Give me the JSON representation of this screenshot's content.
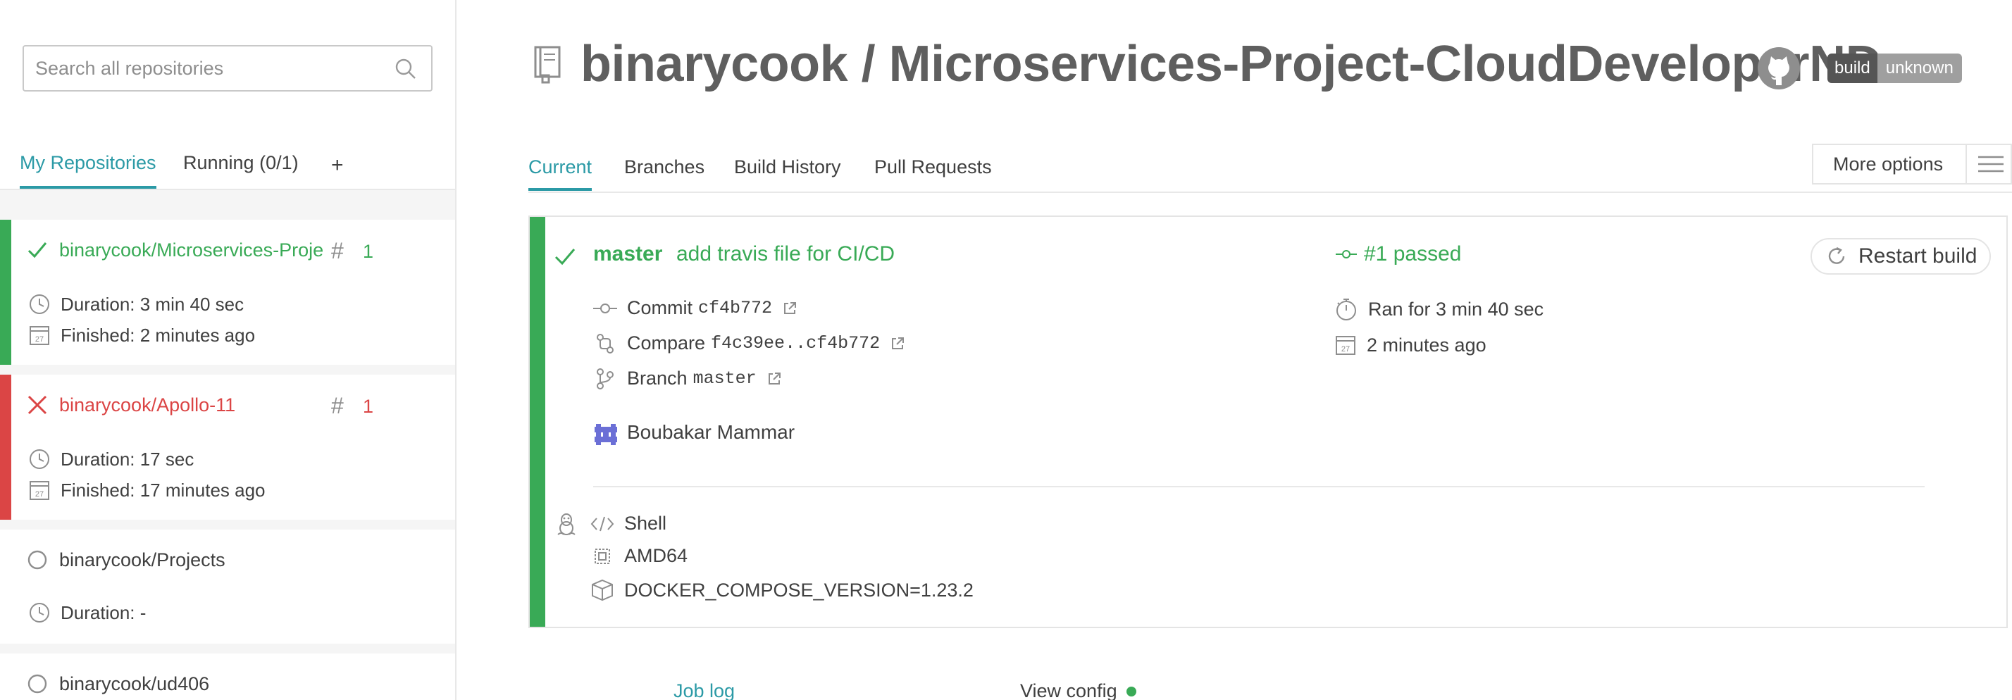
{
  "sidebar": {
    "search_placeholder": "Search all repositories",
    "tabs": [
      {
        "label": "My Repositories",
        "active": true
      },
      {
        "label": "Running (0/1)",
        "active": false
      },
      {
        "label": "+",
        "active": false
      }
    ],
    "repos": [
      {
        "name": "binarycook/Microservices-Project-CloudDeveloperND",
        "status": "passed",
        "hash": "#",
        "number": "1",
        "duration": "Duration: 3 min 40 sec",
        "finished": "Finished: 2 minutes ago",
        "color": "#39aa56"
      },
      {
        "name": "binarycook/Apollo-11",
        "status": "failed",
        "hash": "#",
        "number": "1",
        "duration": "Duration: 17 sec",
        "finished": "Finished: 17 minutes ago",
        "color": "#db4545"
      },
      {
        "name": "binarycook/Projects",
        "status": "none",
        "duration": "Duration: -"
      },
      {
        "name": "binarycook/ud406",
        "status": "none"
      }
    ]
  },
  "header": {
    "title": "binarycook / Microservices-Project-CloudDeveloperND",
    "badge_left": "build",
    "badge_right": "unknown"
  },
  "tabs": [
    "Current",
    "Branches",
    "Build History",
    "Pull Requests"
  ],
  "more_options": "More options",
  "build": {
    "branch": "master",
    "message": "add travis file for CI/CD",
    "status_text": "#1 passed",
    "commit_label": "Commit",
    "commit_sha": "cf4b772",
    "compare_label": "Compare",
    "compare_range": "f4c39ee..cf4b772",
    "branch_label": "Branch",
    "branch_value": "master",
    "ran_for": "Ran for 3 min 40 sec",
    "ago": "2 minutes ago",
    "author": "Boubakar Mammar",
    "restart_label": "Restart build",
    "language": "Shell",
    "arch": "AMD64",
    "env": "DOCKER_COMPOSE_VERSION=1.23.2",
    "calendar_day": "27"
  },
  "footer": {
    "job_log": "Job log",
    "view_config": "View config"
  },
  "colors": {
    "passed": "#39aa56",
    "failed": "#db4545",
    "accent": "#2b9aa6"
  }
}
